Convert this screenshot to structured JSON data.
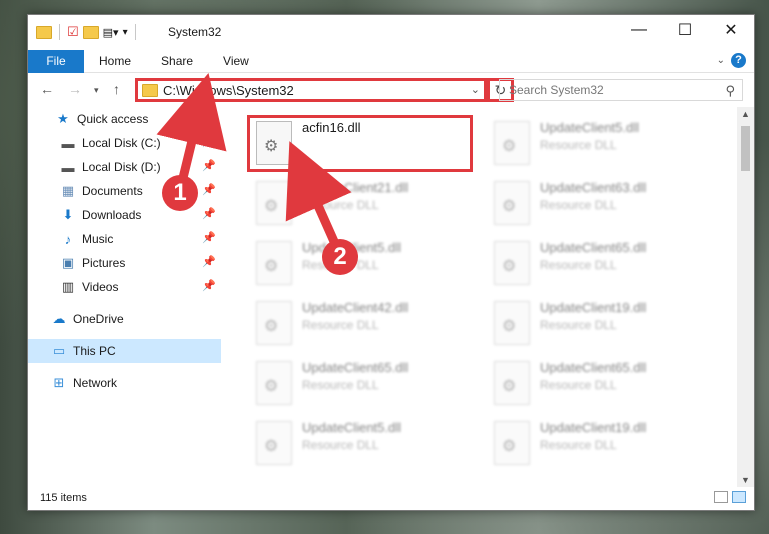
{
  "window": {
    "title": "System32",
    "ribbon_tabs": [
      "File",
      "Home",
      "Share",
      "View"
    ],
    "address_path": "C:\\Windows\\System32",
    "search_placeholder": "Search System32",
    "minimize": "—",
    "maximize": "☐",
    "close": "✕",
    "help": "?"
  },
  "sidebar": {
    "items": [
      {
        "label": "Quick access",
        "icon": "star-icon",
        "pinned": false
      },
      {
        "label": "Local Disk (C:)",
        "icon": "drive-icon",
        "pinned": true
      },
      {
        "label": "Local Disk (D:)",
        "icon": "drive-icon",
        "pinned": true
      },
      {
        "label": "Documents",
        "icon": "documents-icon",
        "pinned": true
      },
      {
        "label": "Downloads",
        "icon": "downloads-icon",
        "pinned": true
      },
      {
        "label": "Music",
        "icon": "music-icon",
        "pinned": true
      },
      {
        "label": "Pictures",
        "icon": "pictures-icon",
        "pinned": true
      },
      {
        "label": "Videos",
        "icon": "videos-icon",
        "pinned": true
      },
      {
        "label": "OneDrive",
        "icon": "cloud-icon",
        "pinned": false
      },
      {
        "label": "This PC",
        "icon": "computer-icon",
        "pinned": false,
        "selected": true
      },
      {
        "label": "Network",
        "icon": "network-icon",
        "pinned": false
      }
    ]
  },
  "files": [
    {
      "name": "acfin16.dll",
      "type": ""
    },
    {
      "name": "UpdateClient5.dll",
      "type": "Resource DLL"
    },
    {
      "name": "UpdateClient21.dll",
      "type": "Resource DLL"
    },
    {
      "name": "UpdateClient63.dll",
      "type": "Resource DLL"
    },
    {
      "name": "UpdateClient5.dll",
      "type": "Resource DLL"
    },
    {
      "name": "UpdateClient65.dll",
      "type": "Resource DLL"
    },
    {
      "name": "UpdateClient42.dll",
      "type": "Resource DLL"
    },
    {
      "name": "UpdateClient19.dll",
      "type": "Resource DLL"
    },
    {
      "name": "UpdateClient65.dll",
      "type": "Resource DLL"
    },
    {
      "name": "UpdateClient65.dll",
      "type": "Resource DLL"
    },
    {
      "name": "UpdateClient5.dll",
      "type": "Resource DLL"
    },
    {
      "name": "UpdateClient19.dll",
      "type": "Resource DLL"
    }
  ],
  "status": {
    "item_count": "115 items"
  },
  "annotations": {
    "step1": "1",
    "step2": "2"
  },
  "colors": {
    "accent": "#1979ca",
    "highlight": "#e0393e",
    "selected": "#cce8ff"
  }
}
